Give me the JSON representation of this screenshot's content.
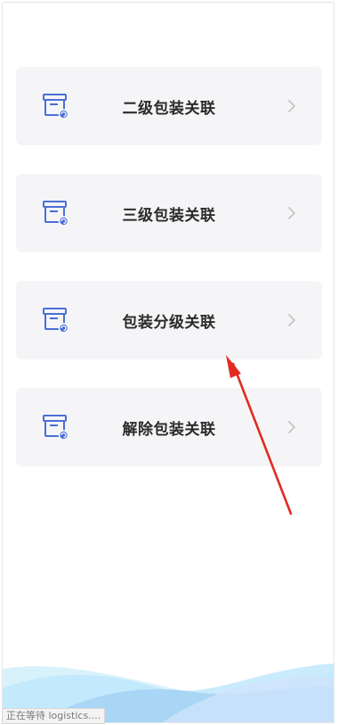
{
  "menu": {
    "items": [
      {
        "label": "二级包装关联",
        "icon": "package-link-icon"
      },
      {
        "label": "三级包装关联",
        "icon": "package-link-icon"
      },
      {
        "label": "包装分级关联",
        "icon": "package-link-icon"
      },
      {
        "label": "解除包装关联",
        "icon": "package-link-icon"
      }
    ]
  },
  "status_bar": {
    "text": "正在等待 logistics...."
  },
  "colors": {
    "card_bg": "#f5f5f7",
    "icon_blue": "#4a6fd6",
    "arrow_red": "#e32a22",
    "wave_light": "#bfe8fb",
    "wave_mid": "#9fcdf3"
  }
}
